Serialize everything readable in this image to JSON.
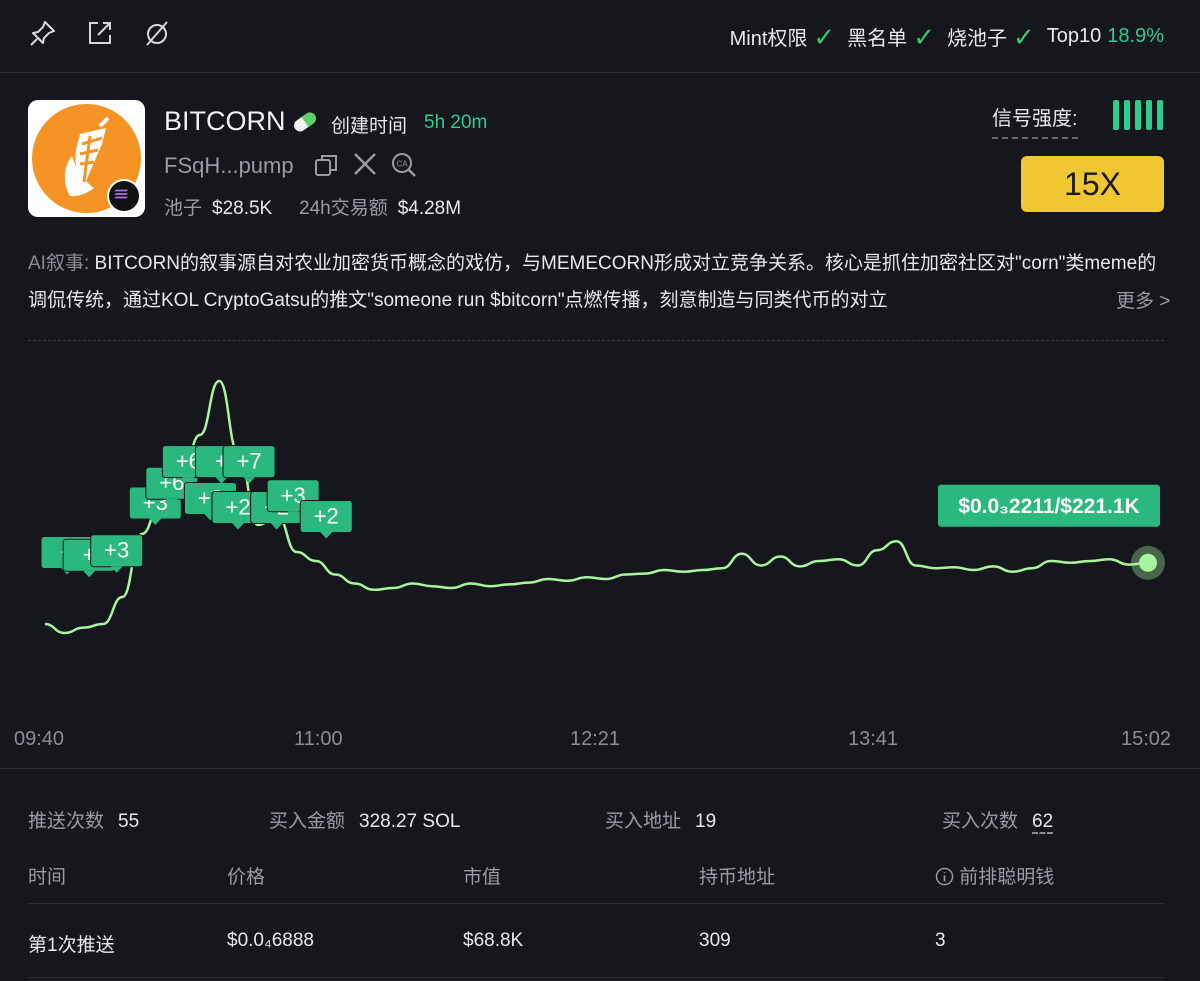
{
  "toolbar": {
    "icons": [
      "pin-icon",
      "external-link-icon",
      "hide-icon"
    ],
    "checks": [
      {
        "label": "Mint权限",
        "status": "✓"
      },
      {
        "label": "黑名单",
        "status": "✓"
      },
      {
        "label": "烧池子",
        "status": "✓"
      }
    ],
    "top10_label": "Top10",
    "top10_value": "18.9%"
  },
  "token": {
    "name": "BITCORN",
    "created_label": "创建时间",
    "created_value": "5h 20m",
    "address": "FSqH...pump",
    "pool_label": "池子",
    "pool_value": "$28.5K",
    "volume_label": "24h交易额",
    "volume_value": "$4.28M",
    "chain_icon": "solana-icon"
  },
  "signal": {
    "label": "信号强度:",
    "strength": 5,
    "multiplier": "15X"
  },
  "ai": {
    "label": "AI叙事:",
    "text": "BITCORN的叙事源自对农业加密货币概念的戏仿，与MEMECORN形成对立竞争关系。核心是抓住加密社区对\"corn\"类meme的调侃传统，通过KOL CryptoGatsu的推文\"someone run $bitcorn\"点燃传播，刻意制造与同类代币的对立",
    "more": "更多 >"
  },
  "chart_data": {
    "type": "line",
    "x_ticks": [
      "09:40",
      "11:00",
      "12:21",
      "13:41",
      "15:02"
    ],
    "line_color": "#a8f5a0",
    "label_color": "#2bb87f",
    "series": [
      {
        "values": [
          40,
          30,
          36,
          40,
          70,
          140,
          175,
          195,
          250,
          310,
          230,
          150,
          160,
          120,
          110,
          95,
          85,
          78,
          80,
          85,
          82,
          80,
          85,
          82,
          84,
          86,
          90,
          88,
          92,
          90,
          95,
          96,
          100,
          98,
          100,
          102,
          118,
          105,
          115,
          104,
          110,
          112,
          105,
          122,
          132,
          105,
          102,
          103,
          100,
          104,
          98,
          102,
          110,
          108,
          110,
          112,
          106,
          108
        ]
      }
    ],
    "push_markers": [
      {
        "text": "+",
        "t": 0.02,
        "v": 95
      },
      {
        "text": "+",
        "t": 0.04,
        "v": 92
      },
      {
        "text": "+3",
        "t": 0.065,
        "v": 97
      },
      {
        "text": "+3",
        "t": 0.1,
        "v": 150
      },
      {
        "text": "+6",
        "t": 0.115,
        "v": 172
      },
      {
        "text": "+6",
        "t": 0.13,
        "v": 196
      },
      {
        "text": "+2",
        "t": 0.15,
        "v": 155
      },
      {
        "text": "+",
        "t": 0.16,
        "v": 196
      },
      {
        "text": "+7",
        "t": 0.185,
        "v": 196
      },
      {
        "text": "+2",
        "t": 0.175,
        "v": 145
      },
      {
        "text": "+2",
        "t": 0.21,
        "v": 145
      },
      {
        "text": "+3",
        "t": 0.225,
        "v": 158
      },
      {
        "text": "+2",
        "t": 0.255,
        "v": 135
      }
    ],
    "current_label": "$0.0₃2211/$221.1K"
  },
  "stats": {
    "push_count_label": "推送次数",
    "push_count": "55",
    "buy_amount_label": "买入金额",
    "buy_amount": "328.27 SOL",
    "buy_addr_label": "买入地址",
    "buy_addr": "19",
    "buy_times_label": "买入次数",
    "buy_times": "62"
  },
  "table": {
    "headers": [
      "时间",
      "价格",
      "市值",
      "持币地址",
      "前排聪明钱"
    ],
    "rows": [
      [
        "第1次推送",
        "$0.0₄6888",
        "$68.8K",
        "309",
        "3"
      ]
    ]
  }
}
